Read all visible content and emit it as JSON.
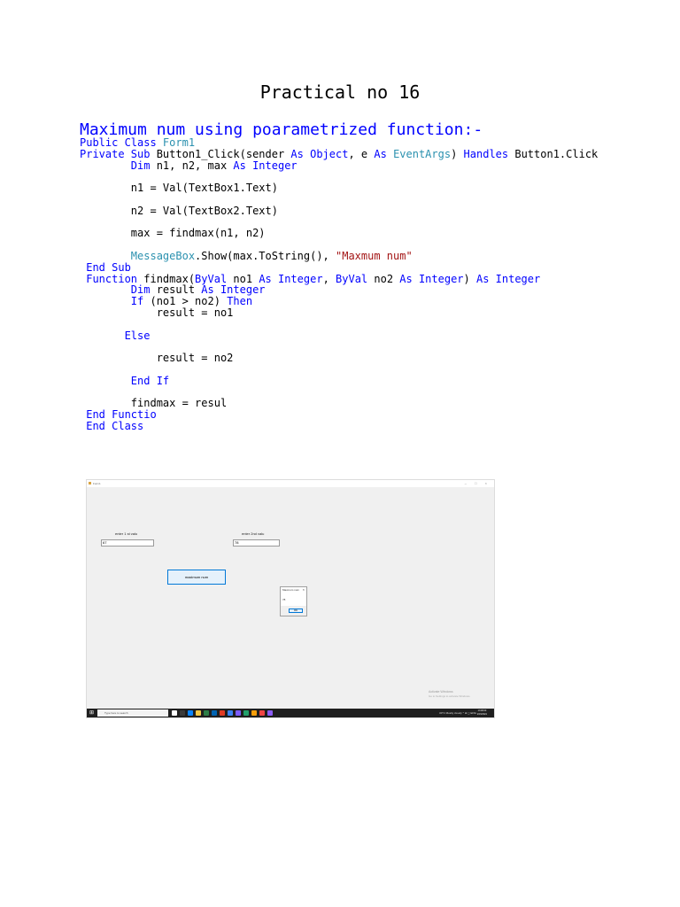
{
  "title": "Practical no 16",
  "heading": "Maximum num using poarametrized function:-",
  "code_lines": [
    [
      {
        "t": "Public Class ",
        "c": "kw"
      },
      {
        "t": "Form1",
        "c": "ty"
      }
    ],
    [
      {
        "t": "Private Sub ",
        "c": "kw"
      },
      {
        "t": "Button1_Click(sender ",
        "c": ""
      },
      {
        "t": "As ",
        "c": "kw"
      },
      {
        "t": "Object",
        "c": "kw"
      },
      {
        "t": ", e ",
        "c": ""
      },
      {
        "t": "As ",
        "c": "kw"
      },
      {
        "t": "EventArgs",
        "c": "ty"
      },
      {
        "t": ") ",
        "c": ""
      },
      {
        "t": "Handles ",
        "c": "kw"
      },
      {
        "t": "Button1.Click",
        "c": ""
      }
    ],
    [
      {
        "t": "        ",
        "c": ""
      },
      {
        "t": "Dim ",
        "c": "kw"
      },
      {
        "t": "n1, n2, max ",
        "c": ""
      },
      {
        "t": "As Integer",
        "c": "kw"
      }
    ],
    [],
    [
      {
        "t": "        n1 = Val(TextBox1.Text)",
        "c": ""
      }
    ],
    [],
    [
      {
        "t": "        n2 = Val(TextBox2.Text)",
        "c": ""
      }
    ],
    [],
    [
      {
        "t": "        max = findmax(n1, n2)",
        "c": ""
      }
    ],
    [],
    [
      {
        "t": "        ",
        "c": ""
      },
      {
        "t": "MessageBox",
        "c": "ty"
      },
      {
        "t": ".Show(max.ToString(), ",
        "c": ""
      },
      {
        "t": "\"Maxmum num\"",
        "c": "str"
      }
    ],
    [
      {
        "t": " End Sub",
        "c": "kw"
      }
    ],
    [
      {
        "t": " Function ",
        "c": "kw"
      },
      {
        "t": "findmax(",
        "c": ""
      },
      {
        "t": "ByVal ",
        "c": "kw"
      },
      {
        "t": "no1 ",
        "c": ""
      },
      {
        "t": "As Integer",
        "c": "kw"
      },
      {
        "t": ", ",
        "c": ""
      },
      {
        "t": "ByVal ",
        "c": "kw"
      },
      {
        "t": "no2 ",
        "c": ""
      },
      {
        "t": "As Integer",
        "c": "kw"
      },
      {
        "t": ") ",
        "c": ""
      },
      {
        "t": "As Integer",
        "c": "kw"
      }
    ],
    [
      {
        "t": "        ",
        "c": ""
      },
      {
        "t": "Dim ",
        "c": "kw"
      },
      {
        "t": "result ",
        "c": ""
      },
      {
        "t": "As Integer",
        "c": "kw"
      }
    ],
    [
      {
        "t": "        ",
        "c": ""
      },
      {
        "t": "If ",
        "c": "kw"
      },
      {
        "t": "(no1 > no2) ",
        "c": ""
      },
      {
        "t": "Then",
        "c": "kw"
      }
    ],
    [
      {
        "t": "            result = no1",
        "c": ""
      }
    ],
    [],
    [
      {
        "t": "       ",
        "c": ""
      },
      {
        "t": "Else",
        "c": "kw"
      }
    ],
    [],
    [
      {
        "t": "            result = no2",
        "c": ""
      }
    ],
    [],
    [
      {
        "t": "        ",
        "c": ""
      },
      {
        "t": "End If",
        "c": "kw"
      }
    ],
    [],
    [
      {
        "t": "        findmax = resul",
        "c": ""
      }
    ],
    [
      {
        "t": " End Functio",
        "c": "kw"
      }
    ],
    [
      {
        "t": " End Class",
        "c": "kw"
      }
    ]
  ],
  "screenshot": {
    "window_title": "Form1",
    "window_controls": "–  □  ×",
    "label1": "enter 1 st valu",
    "label2": "enter 2nd valu",
    "textbox1_value": "67",
    "textbox2_value": "78",
    "button_label": "maximum num",
    "msgbox_title": "Maxmum num",
    "msgbox_close": "×",
    "msgbox_value": "78",
    "msgbox_ok": "OK",
    "watermark_title": "Activate Windows",
    "watermark_sub": "Go to Settings to activate Windows.",
    "search_placeholder": "Type here to search",
    "tray_text": "30°C  Mostly cloudy  ^  ⊕  ◻  ENG",
    "clock_time": "13:08:00",
    "clock_date": "2/15/2021",
    "taskbar_icon_colors": [
      "#ffffff",
      "#3a3a3a",
      "#0a84ff",
      "#f2c744",
      "#2d7d46",
      "#0063b1",
      "#e03b24",
      "#3b82f6",
      "#7c5cff",
      "#22a06b",
      "#f59e0b",
      "#ef4444",
      "#8b5cf6"
    ]
  }
}
